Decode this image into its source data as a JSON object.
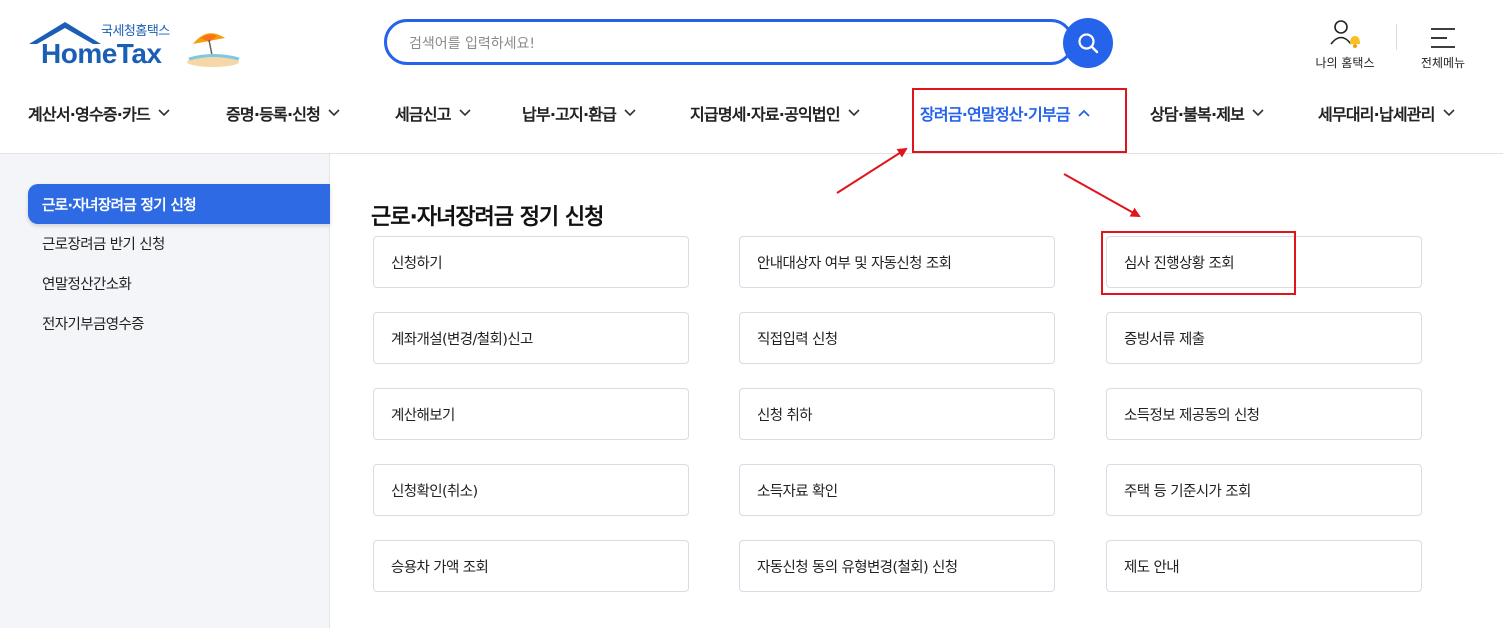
{
  "brand": {
    "logo_sub": "국세청홈택스",
    "logo_main": "HomeTax"
  },
  "search": {
    "placeholder": "검색어를 입력하세요!",
    "value": ""
  },
  "utility": {
    "my_hometax": "나의 홈택스",
    "all_menu": "전체메뉴"
  },
  "gnb": {
    "items": [
      {
        "label": "계산서·영수증·카드"
      },
      {
        "label": "증명·등록·신청"
      },
      {
        "label": "세금신고"
      },
      {
        "label": "납부·고지·환급"
      },
      {
        "label": "지급명세·자료·공익법인"
      },
      {
        "label": "장려금·연말정산·기부금",
        "active": true
      },
      {
        "label": "상담·불복·제보"
      },
      {
        "label": "세무대리·납세관리"
      }
    ]
  },
  "sidebar": {
    "items": [
      {
        "label": "근로·자녀장려금 정기 신청",
        "active": true
      },
      {
        "label": "근로장려금 반기 신청"
      },
      {
        "label": "연말정산간소화"
      },
      {
        "label": "전자기부금영수증"
      }
    ]
  },
  "main": {
    "title": "근로·자녀장려금 정기 신청",
    "cards": [
      "신청하기",
      "안내대상자 여부 및 자동신청 조회",
      "심사 진행상황 조회",
      "계좌개설(변경/철회)신고",
      "직접입력 신청",
      "증빙서류 제출",
      "계산해보기",
      "신청 취하",
      "소득정보 제공동의 신청",
      "신청확인(취소)",
      "소득자료 확인",
      "주택 등 기준시가 조회",
      "승용차 가액 조회",
      "자동신청 동의 유형변경(철회) 신청",
      "제도 안내"
    ]
  },
  "colors": {
    "accent": "#2563eb",
    "brand": "#1a5fb4",
    "annotation": "#e0141b"
  },
  "icons": {
    "search": "search-icon",
    "my": "user-bell-icon",
    "menu": "hamburger-icon",
    "chevron_down": "chevron-down-icon",
    "chevron_up": "chevron-up-icon"
  }
}
